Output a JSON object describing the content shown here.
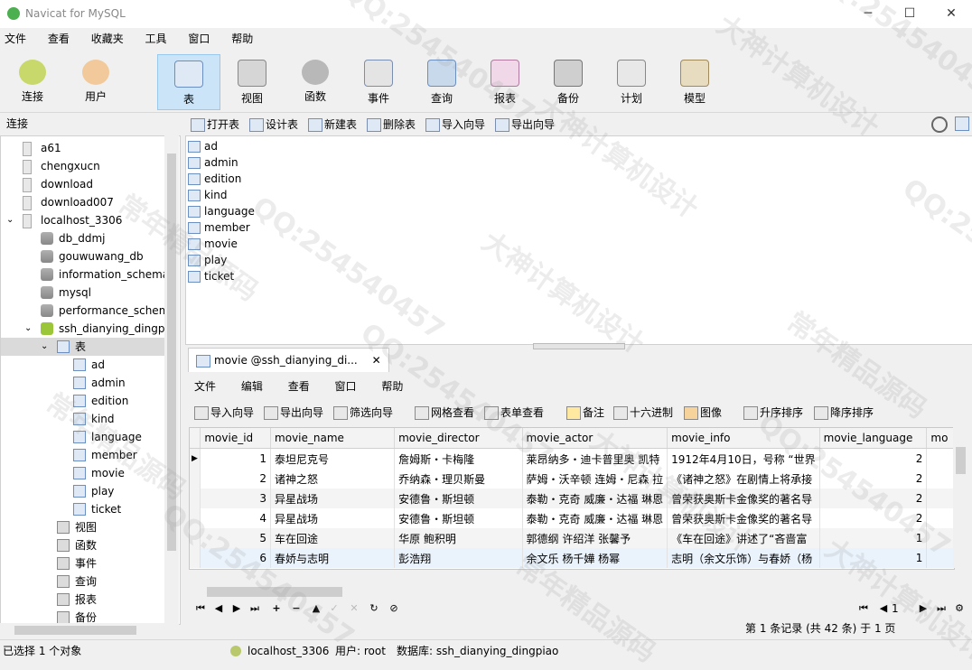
{
  "app": {
    "title": "Navicat for MySQL"
  },
  "window_controls": {
    "minimize": "─",
    "maximize": "☐",
    "close": "✕"
  },
  "menu": [
    "文件",
    "查看",
    "收藏夹",
    "工具",
    "窗口",
    "帮助"
  ],
  "toolbar": [
    {
      "label": "连接",
      "icon": "connect-icon"
    },
    {
      "label": "用户",
      "icon": "user-icon"
    },
    {
      "label": "表",
      "icon": "table-icon"
    },
    {
      "label": "视图",
      "icon": "view-icon"
    },
    {
      "label": "函数",
      "icon": "function-icon"
    },
    {
      "label": "事件",
      "icon": "event-icon"
    },
    {
      "label": "查询",
      "icon": "query-icon"
    },
    {
      "label": "报表",
      "icon": "report-icon"
    },
    {
      "label": "备份",
      "icon": "backup-icon"
    },
    {
      "label": "计划",
      "icon": "schedule-icon"
    },
    {
      "label": "模型",
      "icon": "model-icon"
    }
  ],
  "connection_header": "连接",
  "object_toolbar": [
    "打开表",
    "设计表",
    "新建表",
    "删除表",
    "导入向导",
    "导出向导"
  ],
  "tree": [
    {
      "label": "a61",
      "depth": 0,
      "kind": "conn"
    },
    {
      "label": "chengxucn",
      "depth": 0,
      "kind": "conn"
    },
    {
      "label": "download",
      "depth": 0,
      "kind": "conn"
    },
    {
      "label": "download007",
      "depth": 0,
      "kind": "conn"
    },
    {
      "label": "localhost_3306",
      "depth": 0,
      "kind": "conn-open"
    },
    {
      "label": "db_ddmj",
      "depth": 1,
      "kind": "db"
    },
    {
      "label": "gouwuwang_db",
      "depth": 1,
      "kind": "db"
    },
    {
      "label": "information_schema",
      "depth": 1,
      "kind": "db"
    },
    {
      "label": "mysql",
      "depth": 1,
      "kind": "db"
    },
    {
      "label": "performance_schem",
      "depth": 1,
      "kind": "db"
    },
    {
      "label": "ssh_dianying_dingpia",
      "depth": 1,
      "kind": "db-open"
    },
    {
      "label": "表",
      "depth": 2,
      "kind": "tables-open"
    },
    {
      "label": "ad",
      "depth": 3,
      "kind": "table"
    },
    {
      "label": "admin",
      "depth": 3,
      "kind": "table"
    },
    {
      "label": "edition",
      "depth": 3,
      "kind": "table"
    },
    {
      "label": "kind",
      "depth": 3,
      "kind": "table"
    },
    {
      "label": "language",
      "depth": 3,
      "kind": "table"
    },
    {
      "label": "member",
      "depth": 3,
      "kind": "table"
    },
    {
      "label": "movie",
      "depth": 3,
      "kind": "table"
    },
    {
      "label": "play",
      "depth": 3,
      "kind": "table"
    },
    {
      "label": "ticket",
      "depth": 3,
      "kind": "table"
    },
    {
      "label": "视图",
      "depth": 2,
      "kind": "group"
    },
    {
      "label": "函数",
      "depth": 2,
      "kind": "group"
    },
    {
      "label": "事件",
      "depth": 2,
      "kind": "group"
    },
    {
      "label": "查询",
      "depth": 2,
      "kind": "group"
    },
    {
      "label": "报表",
      "depth": 2,
      "kind": "group"
    },
    {
      "label": "备份",
      "depth": 2,
      "kind": "group"
    }
  ],
  "objects": [
    "ad",
    "admin",
    "edition",
    "kind",
    "language",
    "member",
    "movie",
    "play",
    "ticket"
  ],
  "tab": {
    "title": "movie @ssh_dianying_di...",
    "close": "✕"
  },
  "tab_menu": [
    "文件",
    "编辑",
    "查看",
    "窗口",
    "帮助"
  ],
  "tab_toolbar": [
    "导入向导",
    "导出向导",
    "筛选向导",
    "网格查看",
    "表单查看",
    "备注",
    "十六进制",
    "图像",
    "升序排序",
    "降序排序"
  ],
  "grid": {
    "columns": [
      "movie_id",
      "movie_name",
      "movie_director",
      "movie_actor",
      "movie_info",
      "movie_language",
      "mo"
    ],
    "rows": [
      [
        "1",
        "泰坦尼克号",
        "詹姆斯・卡梅隆",
        "莱昂纳多・迪卡普里奥 凯特",
        "1912年4月10日，号称 “世界",
        "2",
        ""
      ],
      [
        "2",
        "诸神之怒",
        "乔纳森・理贝斯曼",
        "萨姆・沃辛顿 连姆・尼森 拉",
        "《诸神之怒》在剧情上将承接",
        "2",
        ""
      ],
      [
        "3",
        "异星战场",
        "安德鲁・斯坦顿",
        "泰勒・克奇 威廉・达福 琳恩",
        "曾荣获奥斯卡金像奖的著名导",
        "2",
        ""
      ],
      [
        "4",
        "异星战场",
        "安德鲁・斯坦顿",
        "泰勒・克奇 威廉・达福 琳恩",
        "曾荣获奥斯卡金像奖的著名导",
        "2",
        ""
      ],
      [
        "5",
        "车在回途",
        "华原 鲍积明",
        "郭德纲 许绍洋 张馨予",
        "《车在回途》讲述了“吝啬富",
        "1",
        ""
      ],
      [
        "6",
        "春娇与志明",
        "彭浩翔",
        "余文乐 杨千嬅 杨幂",
        "志明（余文乐饰）与春娇（杨",
        "1",
        ""
      ]
    ]
  },
  "navigator": {
    "page": "1"
  },
  "record_info": "第 1 条记录 (共 42 条) 于 1 页",
  "status": {
    "selected": "已选择 1 个对象",
    "connection": "localhost_3306",
    "user": "用户: root",
    "database": "数据库: ssh_dianying_dingpiao"
  },
  "watermarks": [
    "QQ:254540457",
    "大神计算机设计",
    "常年精品源码"
  ]
}
